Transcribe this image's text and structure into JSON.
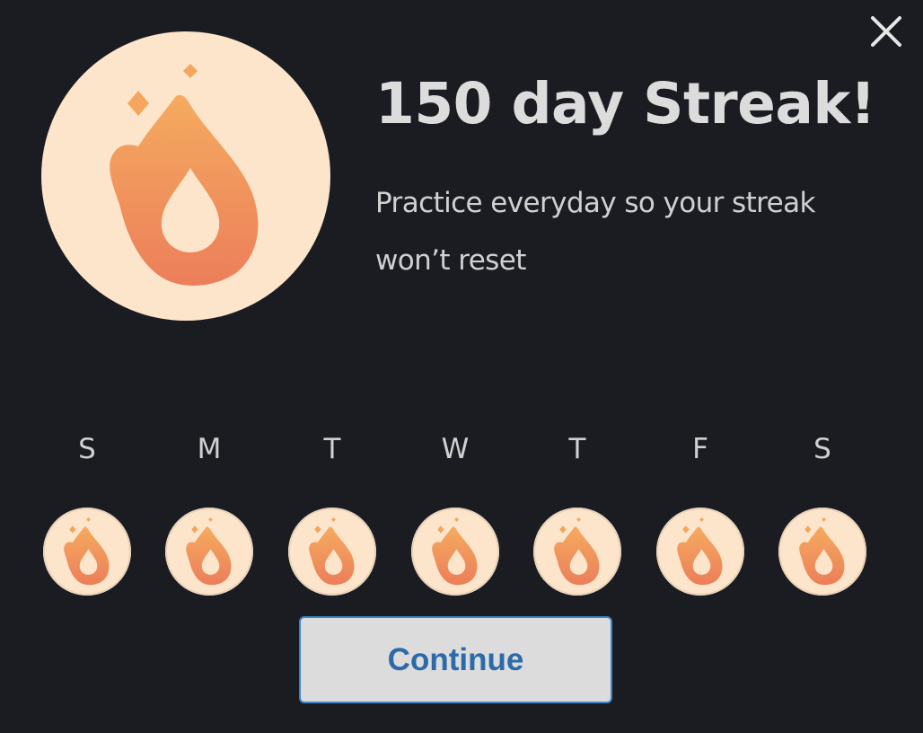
{
  "dialog": {
    "title": "150 day Streak!",
    "message": "Practice everyday so your streak won’t reset",
    "continue_label": "Continue"
  },
  "week": {
    "days": [
      {
        "letter": "S"
      },
      {
        "letter": "M"
      },
      {
        "letter": "T"
      },
      {
        "letter": "W"
      },
      {
        "letter": "T"
      },
      {
        "letter": "F"
      },
      {
        "letter": "S"
      }
    ]
  },
  "icons": {
    "close": "close-icon",
    "streak": "flame-icon"
  },
  "colors": {
    "background": "#1b1c22",
    "badge": "#fde5cb",
    "flame_top": "#f5ab5f",
    "flame_bottom": "#ec7e5a",
    "button_bg": "#dcdcdc",
    "button_text": "#2d6aa8",
    "button_border": "#3f86c9"
  }
}
